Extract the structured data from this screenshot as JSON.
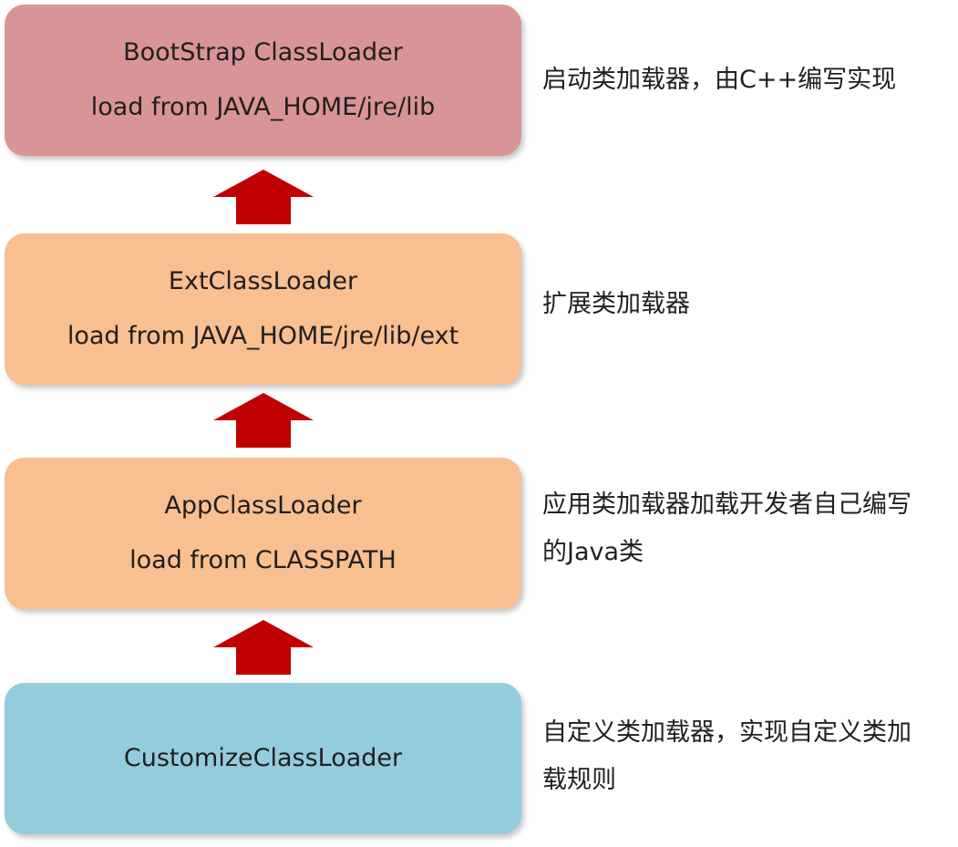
{
  "colors": {
    "bootstrap": "#d99497",
    "ext": "#f8bf90",
    "app": "#f8bf90",
    "custom": "#93ccdd",
    "arrow": "#c00000"
  },
  "loaders": [
    {
      "name": "BootStrap ClassLoader",
      "path": "load from JAVA_HOME/jre/lib",
      "desc": [
        "启动类加载器，由C++编写实现"
      ]
    },
    {
      "name": "ExtClassLoader",
      "path": "load from JAVA_HOME/jre/lib/ext",
      "desc": [
        "扩展类加载器"
      ]
    },
    {
      "name": "AppClassLoader",
      "path": "load from CLASSPATH",
      "desc": [
        "应用类加载器加载开发者自己编写",
        "的Java类"
      ]
    },
    {
      "name": "CustomizeClassLoader",
      "path": "",
      "desc": [
        "自定义类加载器，实现自定义类加",
        "载规则"
      ]
    }
  ],
  "arrow_icon": "arrow-up-icon"
}
